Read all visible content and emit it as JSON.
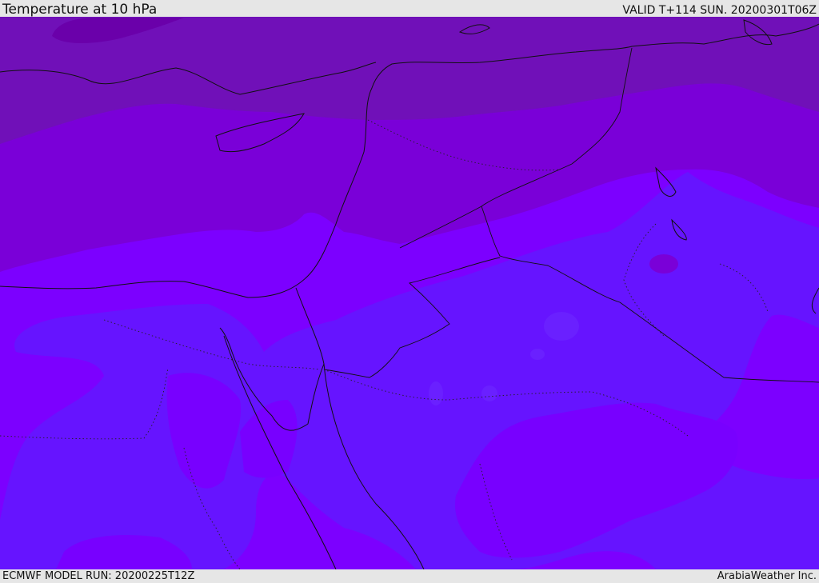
{
  "header": {
    "title": "Temperature at 10 hPa",
    "valid": "VALID T+114 SUN. 20200301T06Z"
  },
  "footer": {
    "model_run": "ECMWF MODEL RUN: 20200225T12Z",
    "credit": "ArabiaWeather Inc."
  },
  "map": {
    "colors": {
      "band_dark": "#6a00aa",
      "band_upper": "#7010b8",
      "band_mid": "#7a00d8",
      "band_bright": "#7c00ff",
      "band_low": "#6614ff",
      "border": "#111111"
    }
  }
}
